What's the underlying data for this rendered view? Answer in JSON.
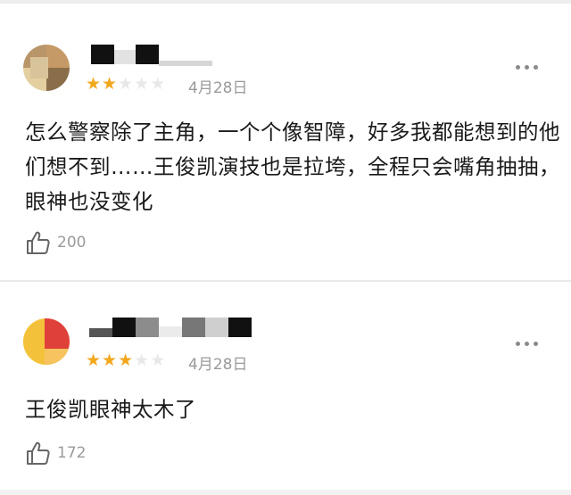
{
  "comments": [
    {
      "rating": 2,
      "max_rating": 5,
      "date": "4月28日",
      "text": "怎么警察除了主角，一个个像智障，好多我都能想到的他们想不到……王俊凯演技也是拉垮，全程只会嘴角抽抽，眼神也没变化",
      "likes": "200",
      "avatar_colors": [
        "#b9956a",
        "#e3cfa0",
        "#8a6e4a",
        "#d8c49a"
      ],
      "name_block_colors": [
        "#111111",
        "#cfcfcf",
        "#111111"
      ]
    },
    {
      "rating": 3,
      "max_rating": 5,
      "date": "4月28日",
      "text": "王俊凯眼神太木了",
      "likes": "172",
      "avatar_colors": [
        "#f4c23a",
        "#e0403a",
        "#f7d066",
        "#c8373a"
      ],
      "name_block_colors": [
        "#111111",
        "#8c8c8c",
        "#e6e6e6",
        "#777777",
        "#cfcfcf",
        "#111111"
      ]
    }
  ],
  "icons": {
    "star": "star-icon",
    "more": "more-icon",
    "like": "thumbs-up-icon"
  },
  "colors": {
    "star_filled": "#f2a81d",
    "star_empty": "#e8e8e8",
    "muted": "#9a9a9a"
  }
}
